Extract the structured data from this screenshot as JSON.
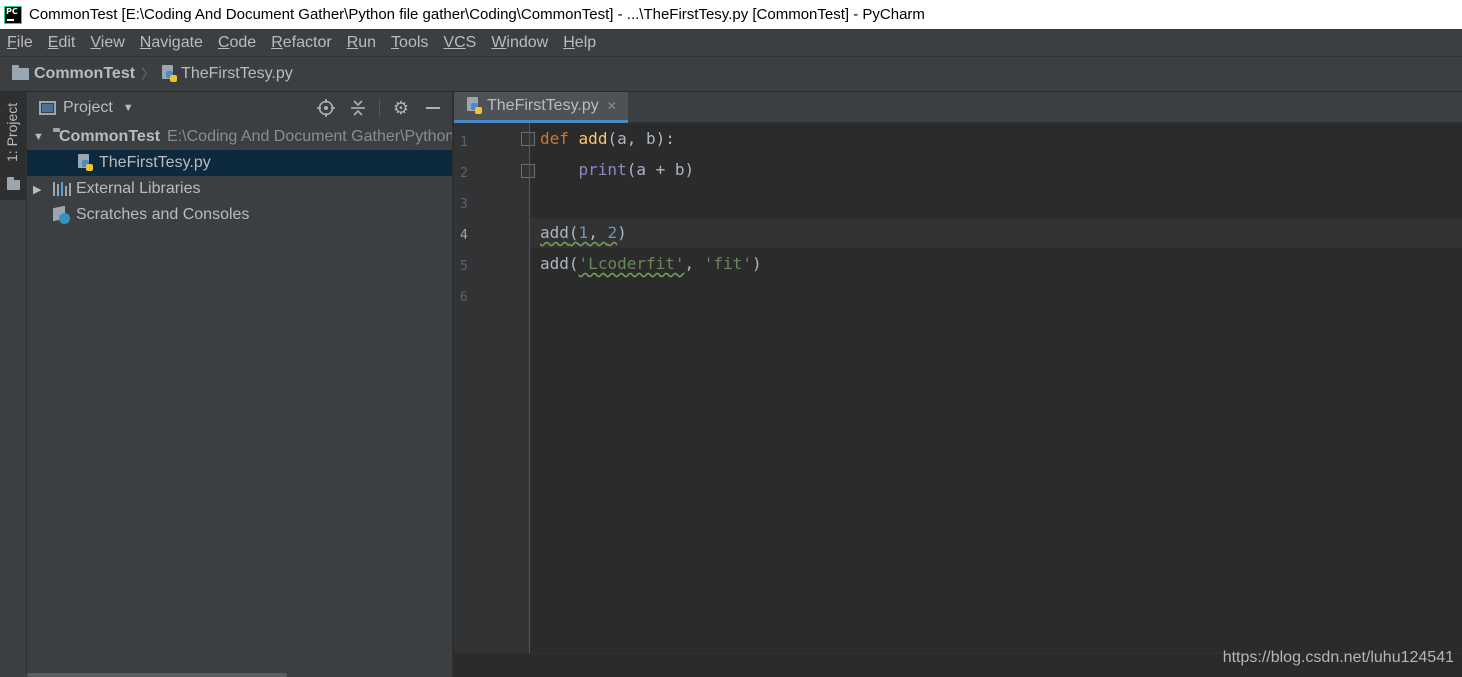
{
  "window": {
    "title": "CommonTest [E:\\Coding And Document Gather\\Python file gather\\Coding\\CommonTest] - ...\\TheFirstTesy.py [CommonTest] - PyCharm",
    "logo_text": "PC"
  },
  "menu": {
    "items": [
      {
        "mnemonic": "F",
        "rest": "ile"
      },
      {
        "mnemonic": "E",
        "rest": "dit"
      },
      {
        "mnemonic": "V",
        "rest": "iew"
      },
      {
        "mnemonic": "N",
        "rest": "avigate"
      },
      {
        "mnemonic": "C",
        "rest": "ode"
      },
      {
        "mnemonic": "R",
        "rest": "efactor"
      },
      {
        "mnemonic": "R",
        "rest": "un"
      },
      {
        "mnemonic": "T",
        "rest": "ools"
      },
      {
        "mnemonic": "VC",
        "rest": "S"
      },
      {
        "mnemonic": "W",
        "rest": "indow"
      },
      {
        "mnemonic": "H",
        "rest": "elp"
      }
    ]
  },
  "breadcrumb": {
    "project": "CommonTest",
    "file": "TheFirstTesy.py"
  },
  "left_stripe": {
    "label": "1: Project"
  },
  "project_panel": {
    "title": "Project",
    "tree": {
      "root_name": "CommonTest",
      "root_path": "E:\\Coding And Document Gather\\Python file gather\\Coding\\CommonTest",
      "file": "TheFirstTesy.py",
      "external": "External Libraries",
      "scratches": "Scratches and Consoles"
    }
  },
  "editor": {
    "tab_label": "TheFirstTesy.py",
    "line_numbers": [
      "1",
      "2",
      "3",
      "4",
      "5",
      "6"
    ],
    "current_line": "4",
    "code": {
      "l1_def": "def",
      "l1_name": "add",
      "l1_open": "(a, b):",
      "l2_indent": "    ",
      "l2_print": "print",
      "l2_rest": "(a + b)",
      "l4_call": "add",
      "l4_open": "(",
      "l4_a": "1",
      "l4_sep": ", ",
      "l4_b": "2",
      "l4_close": ")",
      "l5_call": "add",
      "l5_open": "(",
      "l5_s1": "'Lcoderfit'",
      "l5_sep": ", ",
      "l5_s2": "'fit'",
      "l5_close": ")"
    }
  },
  "watermark": "https://blog.csdn.net/luhu124541",
  "colors": {
    "keyword": "#cc7832",
    "function": "#ffc66d",
    "string": "#6a8759",
    "number": "#6897bb",
    "builtin": "#8888c6",
    "selection": "#0d293e",
    "tab_underline": "#4a88c7"
  }
}
